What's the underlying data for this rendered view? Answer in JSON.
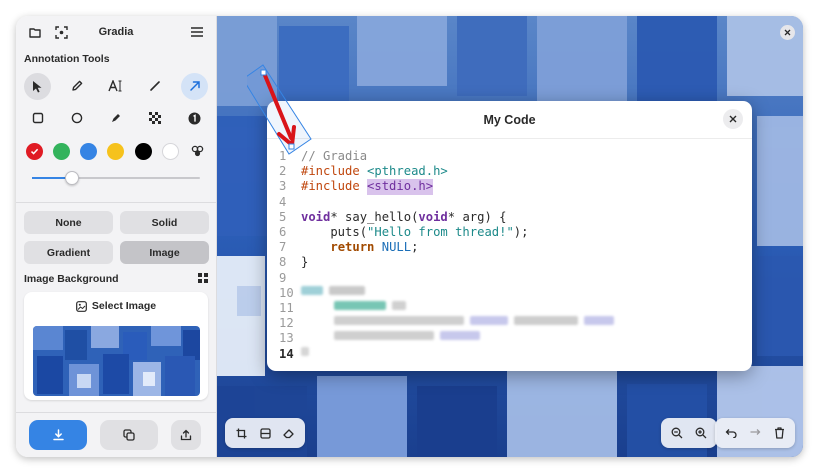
{
  "app": {
    "title": "Gradia"
  },
  "sidebar": {
    "annotation_tools_label": "Annotation Tools",
    "tools_row1": [
      "pointer-icon",
      "pencil-icon",
      "text-icon",
      "line-icon",
      "arrow-icon"
    ],
    "tools_row2": [
      "square-icon",
      "circle-icon",
      "highlighter-icon",
      "pixelate-icon",
      "number-icon"
    ],
    "colors": [
      "#e01b24",
      "#33b35c",
      "#3584e4",
      "#f6c21c",
      "#000000",
      "#ffffff"
    ],
    "selected_color": "#e01b24",
    "stroke_width": 0.24,
    "background_options": [
      "None",
      "Solid",
      "Gradient",
      "Image"
    ],
    "selected_background": "Image",
    "image_background_label": "Image Background",
    "select_image_label": "Select Image"
  },
  "code_window": {
    "title": "My Code",
    "current_line": "14",
    "line_numbers": [
      "1",
      "2",
      "3",
      "4",
      "5",
      "6",
      "7",
      "8",
      "9",
      "10",
      "11",
      "12",
      "13",
      "14"
    ],
    "lines": {
      "l1": "// Gradia",
      "l2_directive": "#include",
      "l2_header": "<pthread.h>",
      "l3_directive": "#include",
      "l3_header": "<stdio.h>",
      "l5_type": "void",
      "l5_mid": "* say_hello(",
      "l5_type2": "void",
      "l5_end": "* arg) {",
      "l6_start": "    puts(",
      "l6_str": "\"Hello from thread!\"",
      "l6_end": ");",
      "l7_kw": "return",
      "l7_const": "NULL",
      "l7_end": ";",
      "l8": "}"
    }
  }
}
